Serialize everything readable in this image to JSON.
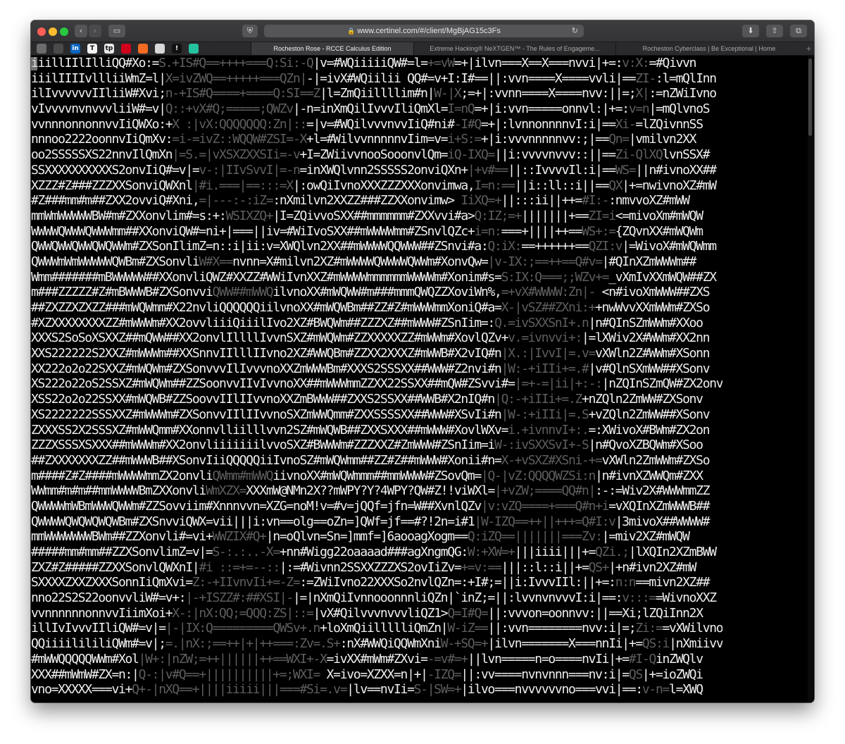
{
  "browser": {
    "url": "www.certinel.com/#/client/MgBjAG15c3Fs",
    "icons": [
      "back-icon",
      "forward-icon",
      "sidebar-icon",
      "shield-icon",
      "lock-icon",
      "reload-icon",
      "download-icon",
      "share-icon",
      "tabs-overview-icon"
    ],
    "favorites": [
      {
        "name": "favorite-1",
        "label": "",
        "color": "#6c6c6c"
      },
      {
        "name": "favorite-2",
        "label": "",
        "color": "#4a4a4a"
      },
      {
        "name": "favorite-linkedin",
        "label": "in",
        "color": "#0a66c2"
      },
      {
        "name": "favorite-nyt",
        "label": "T",
        "color": "#f2f2f2"
      },
      {
        "name": "favorite-tp",
        "label": "tp",
        "color": "#e8e8e8"
      },
      {
        "name": "favorite-red",
        "label": "",
        "color": "#d0021b"
      },
      {
        "name": "favorite-orange",
        "label": "",
        "color": "#f36b21"
      },
      {
        "name": "favorite-camera",
        "label": "",
        "color": "#d8d8d8"
      },
      {
        "name": "favorite-black",
        "label": "!",
        "color": "#111111"
      },
      {
        "name": "favorite-teal",
        "label": "",
        "color": "#25c2a0"
      }
    ],
    "tabs": [
      {
        "label": "Rocheston Rose - RCCE Calculus Edition",
        "active": true
      },
      {
        "label": "Extreme Hacking® NeXTGEN™ - The Rules of Engageme...",
        "active": false
      },
      {
        "label": "Rocheston Cyberclass | Be Exceptional | Home",
        "active": false
      }
    ],
    "new_tab": "+"
  },
  "ascii_lines": [
    [
      [
        "iiillIIlIlliQQ#Xo:=",
        "b"
      ],
      [
        "S.+IS#Q==++++===Q:Si:-Q",
        "d"
      ],
      [
        "|v=#WQiiiiiQW#=l=",
        "b"
      ],
      [
        "+=vW",
        "d"
      ],
      [
        "=+|ilvn===X==X===nvvi|+=:",
        "b"
      ],
      [
        "v:X:",
        "d"
      ],
      [
        "=#Qivvn",
        "b"
      ]
    ],
    [
      [
        "iiilIIIIvllliiWmZ=l|",
        "b"
      ],
      [
        "X=ivZWQ==+++++===QZn|",
        "d"
      ],
      [
        "-|=ivX#WQiilii QQ#=v+I:I#==||:vvn====X====vvli|==",
        "b"
      ],
      [
        "ZI-",
        "d"
      ],
      [
        ":l=mQlInn",
        "b"
      ]
    ],
    [
      [
        "ilIvvvvvvIIliiW#Xvi;",
        "b"
      ],
      [
        "n-+IS#Q====+====Q:SI==Z",
        "d"
      ],
      [
        "|l=ZmQiillllim#n|",
        "b"
      ],
      [
        "W-|X",
        "d"
      ],
      [
        ";=+|:vvnn====X====nvv:||=;",
        "b"
      ],
      [
        "X|",
        "d"
      ],
      [
        ":=nZWiIvno",
        "b"
      ]
    ],
    [
      [
        "vIvvvvnvnvvvliiW#=v|",
        "b"
      ],
      [
        "Q::+vX#Q;=====;QWZv",
        "d"
      ],
      [
        "|-n=inXmQilIvvvIliQmXl=",
        "b"
      ],
      [
        "I=nQ",
        "d"
      ],
      [
        "=+|i:vvn=====onnvl:|+=:",
        "b"
      ],
      [
        "v=n",
        "d"
      ],
      [
        "|=mQlvnoS",
        "b"
      ]
    ],
    [
      [
        "vvnnnonnonnvvIiQWXo:+",
        "b"
      ],
      [
        "X :|vX:QQQQQQQ:Zn|::",
        "d"
      ],
      [
        "=|v=#WQilvvvnvvIiQ#ni#",
        "b"
      ],
      [
        "-I#Q",
        "d"
      ],
      [
        "=+|:lvnnonnnnvI:i|==",
        "b"
      ],
      [
        "Xi-",
        "d"
      ],
      [
        "=lZQivnnSS",
        "b"
      ]
    ],
    [
      [
        "nnnoo2222oonnvIiQmXv:",
        "b"
      ],
      [
        "=i-=ivZ::WQQW#ZSI=-X",
        "d"
      ],
      [
        "+l=#WilvvnnnnnvIim=v=",
        "b"
      ],
      [
        "i+S:=",
        "d"
      ],
      [
        "+|i:vvvnnnnnvv:;|==",
        "b"
      ],
      [
        "Qn=",
        "d"
      ],
      [
        "|vmilvn2XX",
        "b"
      ]
    ],
    [
      [
        "oo2SSSSSXS22nnvIlQmXn",
        "b"
      ],
      [
        "|=S.=|vXSXZXXSIi=-v",
        "d"
      ],
      [
        "+I=ZWiivvnooSooonvlQm=",
        "b"
      ],
      [
        "iQ-IXQ=",
        "d"
      ],
      [
        "||i:vvvvnvvv::||==",
        "b"
      ],
      [
        "Zi-QlXQ",
        "d"
      ],
      [
        "lvnSSX#",
        "b"
      ]
    ],
    [
      [
        "SSXXXXXXXXXXS2onvIiQ#=v|=",
        "b"
      ],
      [
        "v-:|IIvSvvI|=-n",
        "d"
      ],
      [
        "=inXWQlvnn2SSSSS2onviQXn+",
        "b"
      ],
      [
        "|+v#==",
        "d"
      ],
      [
        "||::IvvvvIl:i|==",
        "b"
      ],
      [
        "WS=",
        "d"
      ],
      [
        "||n#ivnoXX##",
        "b"
      ]
    ],
    [
      [
        "XZZZ#Z###ZZZXXSonviQWXnl",
        "b"
      ],
      [
        "|#i.===|==:::=X",
        "d"
      ],
      [
        "|:owQiIvnoXXXZZZXXXonvimwa,",
        "b"
      ],
      [
        "I=n:==",
        "d"
      ],
      [
        "||i::ll::i||==",
        "b"
      ],
      [
        "QX",
        "d"
      ],
      [
        "|+=nwivnoXZ#mW",
        "b"
      ]
    ],
    [
      [
        "#Z###mm#m##ZXX2ovviQ#Xni,",
        "b"
      ],
      [
        "=|---:-:iZ=",
        "d"
      ],
      [
        ":nXmilvn2XXZZ###ZZXXonvimw>",
        "b"
      ],
      [
        " IiXQ=+",
        "d"
      ],
      [
        "||:::ii||++=",
        "b"
      ],
      [
        "#I:-",
        "d"
      ],
      [
        ":nmvvoXZ#mWW",
        "b"
      ]
    ],
    [
      [
        "mmWmWWWWWBW#m#ZXXonvlim#=s:+:",
        "b"
      ],
      [
        "WSIXZQ+",
        "d"
      ],
      [
        "|I=ZQivvoSXX##mmmmmm#ZXXvvi#a>",
        "b"
      ],
      [
        "Q:IZ;=+",
        "d"
      ],
      [
        "|||||||+==",
        "b"
      ],
      [
        "ZI=i",
        "d"
      ],
      [
        "<=mivoXm#mWQW",
        "b"
      ]
    ],
    [
      [
        "WWWWQWWWQWWWmm##XXonviQW#=ni+|===||iv=#WiIvoSXX##mWWWWmm#ZSnvlQZc+",
        "b"
      ],
      [
        "i=n:",
        "d"
      ],
      [
        "===+||||++==",
        "b"
      ],
      [
        "WS+:=",
        "d"
      ],
      [
        "{ZQvnXX#mWQWm",
        "b"
      ]
    ],
    [
      [
        "QWWQWWQWWQWQWWm#ZXSonIlimZ=n::i|ii:v=XWQlvn2XX##mWWWWQQWWW##ZSnvi#a:",
        "b"
      ],
      [
        "Q:iX:",
        "d"
      ],
      [
        "==++++++==",
        "b"
      ],
      [
        "QZI:v",
        "d"
      ],
      [
        "|=WivoX#mWQWmm",
        "b"
      ]
    ],
    [
      [
        "QWWWmWmWWWWWQWBm#ZXSonvli",
        "b"
      ],
      [
        "W#X==",
        "d"
      ],
      [
        "nvnn=X#milvn2XZ#mWWWWQWWWWQWWm#XonvQw=",
        "b"
      ],
      [
        "|v-IX:;==++==",
        "d"
      ],
      [
        "Q#v=",
        "d"
      ],
      [
        "|#QInXZmWWWm##",
        "b"
      ]
    ],
    [
      [
        "Wmm#######mBWWWWW##XXonvliQWZ#XXZZ#WW",
        "b"
      ],
      [
        "iIvnXXZ#mWWWWmmmmmmWWWWm#Xonim#s=",
        "b"
      ],
      [
        "S:IX:Q===;;WZv+=",
        "d"
      ],
      [
        "_vXmIvXXmWQW##ZX",
        "b"
      ]
    ],
    [
      [
        "m###ZZZZZ#Z#mBWWWB#ZXSonvvi",
        "b"
      ],
      [
        "QWW##mWWQ",
        "d"
      ],
      [
        "ilvnoXX#mWQWW#m###mmmQWQZZXoviWn%,",
        "b"
      ],
      [
        "=+vX#WWWW:Zn|-",
        "d"
      ],
      [
        " <n#ivoXmWWW##ZXS",
        "b"
      ]
    ],
    [
      [
        "##ZXZZXZXZZ###mWQWmm#X22nvliQQQQQQiilvnoXX#mWQWBm##ZZ#Z#mWWWmmXoniQ#a=",
        "b"
      ],
      [
        "X-|vSZ##ZXni:+",
        "d"
      ],
      [
        "+nwWvvXXmWWm#ZXSo",
        "b"
      ]
    ],
    [
      [
        "#XZXXXXXXXXZZ#mWWWm#XX2ovvliiiQiiilIvo2XZ#BWQWm##ZZZXZ##mWWW#ZSnIim=:",
        "b"
      ],
      [
        "Q.=ivSXXSnI+.n",
        "d"
      ],
      [
        "|n#QInSZmWWm#XXoo",
        "b"
      ]
    ],
    [
      [
        "XXXS2SoSoXSXXZ##mQWW##XX2onvlIllllIvvnSXZ#mWQWm#ZZXXXXXZZ#mWWm#XovlQZv+",
        "b"
      ],
      [
        "v.=ivnvvi+:",
        "d"
      ],
      [
        "|=lXWiv2X#WWm#XX2nn",
        "b"
      ]
    ],
    [
      [
        "XXS222222S2XXZ#mWWWm##XXSnnvIIlllIIvno2XZ#WWQBm#ZZXX2XXXZ#mWWB#X2vIQ#n",
        "b"
      ],
      [
        "|X.:|IvvI|=.v=",
        "d"
      ],
      [
        "vXWln2Z#WWm#XSonn",
        "b"
      ]
    ],
    [
      [
        "XX222o2o22SXXZ#mWQWm#ZXSonvvvIlIvvvnoXXZmWWWBm#XXXS2SSSXX##WWW#Z2nvi#n",
        "b"
      ],
      [
        "|W:-+iIIi+=.#",
        "d"
      ],
      [
        "|v#QlnSXmWW##XSonv",
        "b"
      ]
    ],
    [
      [
        "XS222o22oS2SSXZ#mWQWm##ZZSoonvvIIvIvvnoXX##mWWWmmZZXX22SSXX##mQW#ZSvvi#=",
        "b"
      ],
      [
        "|=+-=|ii|+:-:",
        "d"
      ],
      [
        "|nZQInSZmQW#ZX2onv",
        "b"
      ]
    ],
    [
      [
        "XSS22o2o22SSXX#mWQWB#ZZSoovvIIlIIvvnoXXZmBWWW##ZXXS2SSXX##WWB#X2nIQ#n",
        "b"
      ],
      [
        "|Q:-+iIIi+=.Z",
        "d"
      ],
      [
        "+nZQln2ZmWW#ZXSonv",
        "b"
      ]
    ],
    [
      [
        "XS2222222SSSXXZ#mWWWm#ZXSonvvIIlIIvvnoSXZmWWQmm#ZXXSSSSXX##WWW#XSvIi#n",
        "b"
      ],
      [
        "|W-:+iIIi|=.S",
        "d"
      ],
      [
        "+vZQln2ZmWW##XSonv",
        "b"
      ]
    ],
    [
      [
        "ZXXXSS2X2SSSXZ#mWWQmm#XXonnvlliilllvvn2SZ#mWQWB##ZXXSXXX##mWWW#XovlWXv=",
        "b"
      ],
      [
        "i.+ivnnvI+:.",
        "d"
      ],
      [
        "=:XWivoX#BWm#ZX2on",
        "b"
      ]
    ],
    [
      [
        "ZZZXSSSXSXXX##mWWWm#XX2onvliiiiiiilvvoSXZ#BWWWm#ZZZXXZ#ZmWWW#ZSnIim=i",
        "b"
      ],
      [
        "W-:ivSXXSvI+-S",
        "d"
      ],
      [
        "|n#QvoXZBQWm#XSoo",
        "b"
      ]
    ],
    [
      [
        "##ZXXXXXXXZZ##mWWWB##XSonvIiiQQQQQiiIvnoSZ#mWQWmm##ZZ#Z##mWWW#Xonii#n=",
        "b"
      ],
      [
        "X-+vSXZ#XSni-+=",
        "d"
      ],
      [
        "vXWln2ZmWWm#ZXSo",
        "b"
      ]
    ],
    [
      [
        "m####Z#Z####mWWWWmmZX2onvli",
        "b"
      ],
      [
        "QWmm#mWWQ",
        "d"
      ],
      [
        "iivnoXX#mWQWmmm##mmWWWW#ZSovQm=",
        "b"
      ],
      [
        "|Q-|vZ:QQQQWZSi:n",
        "d"
      ],
      [
        "|n#ivnXZWWQm#ZXX",
        "b"
      ]
    ],
    [
      [
        "WWmm#m#m##mmWWWWBmZXXonvli",
        "b"
      ],
      [
        "WmXZX=",
        "d"
      ],
      [
        "XXXmW@NMn2X??mWPY?Y?4WPY?QW#Z!!viWXl=",
        "b"
      ],
      [
        "|+vZW;====QQ#n|",
        "d"
      ],
      [
        ":-:=Wiv2X#WWWmmZZ",
        "b"
      ]
    ],
    [
      [
        "QWWWWmWBmWWWQWWm#ZZSovviim#Xnnnvvn=XZG=noM!v=#v=jQQf=jfn=W##XvnlQZv",
        "b"
      ],
      [
        "|v:vZQ====+===Q#n+i",
        "d"
      ],
      [
        "=vXQInXZmWWWB##",
        "b"
      ]
    ],
    [
      [
        "QWWWWQWQWQWQWBm#ZXSnvviQWX=vii|||i:vn==olg==oZn=]QWf=jf==#?!2n=i#1",
        "b"
      ],
      [
        "|W-IZQ==++",
        "d"
      ],
      [
        "||+++=Q#I:v",
        "d"
      ],
      [
        "|3mivoX##WWWW#",
        "b"
      ]
    ],
    [
      [
        "mmWWWWWWWBWm##ZZXonvli#=vi+",
        "b"
      ],
      [
        "WWZIX#Q+",
        "d"
      ],
      [
        "|n=oQlvn=Sn=]mmf=]6aooagXogm==",
        "b"
      ],
      [
        "Q:iZQ==",
        "d"
      ],
      [
        "|||||||===Zv:",
        "d"
      ],
      [
        "|=miv2XZ#mWQW",
        "b"
      ]
    ],
    [
      [
        "#####mm#mm##ZZXSonvlimZ=v|=",
        "b"
      ],
      [
        "S-:.:..-X=",
        "d"
      ],
      [
        "+nn#Wigg22oaaaad###agXngmQG:",
        "b"
      ],
      [
        "W:+XW=+",
        "d"
      ],
      [
        "|||iiii|||+=",
        "b"
      ],
      [
        "QZi.;",
        "d"
      ],
      [
        "|lXQIn2XZmBWW",
        "b"
      ]
    ],
    [
      [
        "ZXZ#Z#####ZZXXSonvlQWXnI|",
        "b"
      ],
      [
        "#i ::=+=--::",
        "d"
      ],
      [
        "|:=#Wivnn2SSXXZZZXS2ovIiZv=",
        "b"
      ],
      [
        "+=v:==",
        "d"
      ],
      [
        "|||::l::i||+=",
        "b"
      ],
      [
        "QS+",
        "d"
      ],
      [
        "|+n#ivn2XZ#mW",
        "b"
      ]
    ],
    [
      [
        "SXXXXZXXZXXXSonnIiQmXvi=",
        "b"
      ],
      [
        "Z:-+IIvnvIi+=-Z=",
        "d"
      ],
      [
        ":=ZWiIvno22XXXSo2nvlQZn=:+I#;=||i:IvvvIIl:||+=:",
        "b"
      ],
      [
        "n:n",
        "d"
      ],
      [
        "==mivn2XZ##",
        "b"
      ]
    ],
    [
      [
        "nno22S2S22oonvvliW#=v+:",
        "b"
      ],
      [
        "|-+ISZZ#:##XSI|-",
        "d"
      ],
      [
        "|=|nXmQiIvnnooonnnliQZn|`inZ;=||:lvvnvnvvvI:i|==:",
        "b"
      ],
      [
        "v:::=",
        "d"
      ],
      [
        "=WivnoXXZ",
        "b"
      ]
    ],
    [
      [
        "vvnnnnnnonnvvIiimXoi+",
        "b"
      ],
      [
        "X-:|nX:QQ;=QQQ:ZS|::=",
        "d"
      ],
      [
        "|vX#QilvvvnvvvliQZ1>",
        "b"
      ],
      [
        "Q=I#Q=",
        "d"
      ],
      [
        "||:vvvon=oonnvv:||==Xi;",
        "b"
      ],
      [
        "lZQiInn2X",
        "b"
      ]
    ],
    [
      [
        "illIvIvvvIIliQW#=v|=",
        "b"
      ],
      [
        "|-|IX:Q=========QWSv+.n",
        "d"
      ],
      [
        "+loXmQiillllliQmZn|",
        "b"
      ],
      [
        "W-iZ==",
        "d"
      ],
      [
        "||:vvn========nvv:i|=;",
        "b"
      ],
      [
        "Zi:=",
        "d"
      ],
      [
        "=vXWilvno",
        "b"
      ]
    ],
    [
      [
        "QQiiiilililiQWm#=v|;",
        "b"
      ],
      [
        "=.|nX:;==++|+|++===:Zv=.S+",
        "d"
      ],
      [
        ":nX#WWQiQQWmXni",
        "b"
      ],
      [
        "W-+SQ=+",
        "d"
      ],
      [
        "|ilvn=======X===nnIi|+=",
        "b"
      ],
      [
        "QS:i",
        "d"
      ],
      [
        "|nXmiivv",
        "b"
      ]
    ],
    [
      [
        "#mWWQQQQQWWm#Xol",
        "b"
      ],
      [
        "|W+:|nZW;=++||||||++==WXI+-X",
        "d"
      ],
      [
        "=ivXX#mWm#ZXvi=",
        "b"
      ],
      [
        "-=v#=+",
        "d"
      ],
      [
        "||lvn=====n=o====nvIi|+=",
        "b"
      ],
      [
        "#I-Q",
        "d"
      ],
      [
        "inZWQlv",
        "b"
      ]
    ],
    [
      [
        "XXX##mWmW#ZX=n:|",
        "b"
      ],
      [
        "Q-:|v#Q==+||||||||||+=;WXI=",
        "d"
      ],
      [
        " X=ivo=XZXX=n|+|",
        "b"
      ],
      [
        "-IZQ=",
        "d"
      ],
      [
        "||:vv====nvnvnnn===nv:i|=",
        "b"
      ],
      [
        "QS",
        "d"
      ],
      [
        "|+=ioZWQi",
        "b"
      ]
    ],
    [
      [
        "vno=XXXXX===vi+",
        "b"
      ],
      [
        "Q+-|nXQ==+||||iiiii|||===#Si=.v=",
        "d"
      ],
      [
        "|lv==nvIi=",
        "b"
      ],
      [
        "S-|SW=+",
        "d"
      ],
      [
        "|ilvo===nvvvvvvno===vvi|==:",
        "b"
      ],
      [
        "v-n=",
        "d"
      ],
      [
        "l=XWQ",
        "b"
      ]
    ]
  ]
}
